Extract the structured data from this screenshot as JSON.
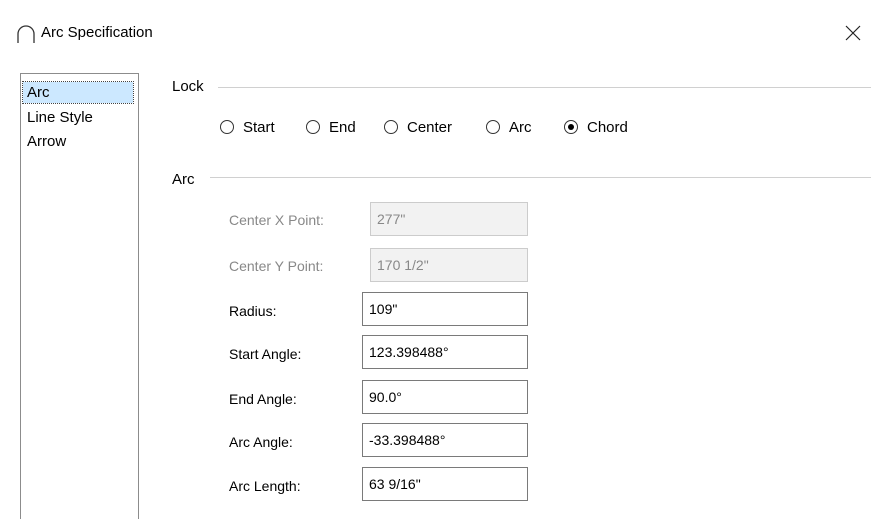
{
  "window": {
    "title": "Arc Specification",
    "icon": "arc-icon",
    "close_icon": "close-icon"
  },
  "sidebar": {
    "items": [
      {
        "label": "Arc",
        "selected": true
      },
      {
        "label": "Line Style",
        "selected": false
      },
      {
        "label": "Arrow",
        "selected": false
      }
    ]
  },
  "lock": {
    "label": "Lock",
    "options": [
      {
        "label": "Start",
        "checked": false
      },
      {
        "label": "End",
        "checked": false
      },
      {
        "label": "Center",
        "checked": false
      },
      {
        "label": "Arc",
        "checked": false
      },
      {
        "label": "Chord",
        "checked": true
      }
    ]
  },
  "arc": {
    "label": "Arc",
    "fields": [
      {
        "label": "Center X Point:",
        "value": "277\"",
        "enabled": false
      },
      {
        "label": "Center Y Point:",
        "value": "170 1/2\"",
        "enabled": false
      },
      {
        "label": "Radius:",
        "value": "109\"",
        "enabled": true
      },
      {
        "label": "Start Angle:",
        "value": "123.398488°",
        "enabled": true
      },
      {
        "label": "End Angle:",
        "value": "90.0°",
        "enabled": true
      },
      {
        "label": "Arc Angle:",
        "value": "-33.398488°",
        "enabled": true
      },
      {
        "label": "Arc Length:",
        "value": "63 9/16\"",
        "enabled": true
      }
    ]
  },
  "colors": {
    "selection": "#cce8ff",
    "disabled_text": "#888888",
    "group_line": "#d0d0d0"
  }
}
